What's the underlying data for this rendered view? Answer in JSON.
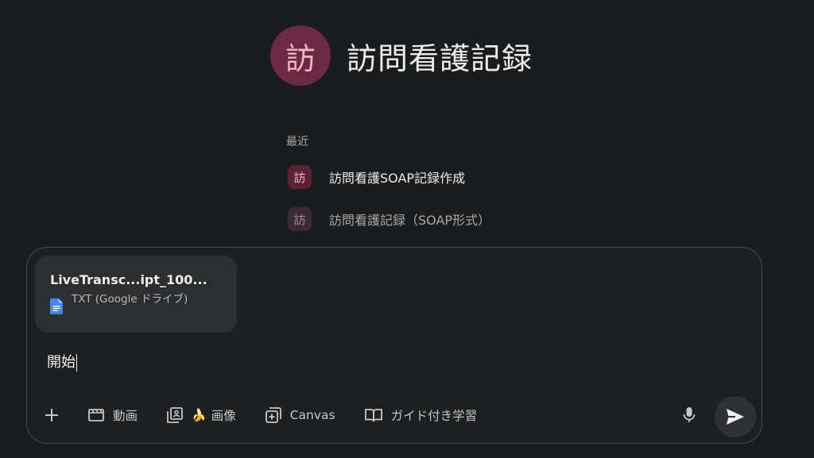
{
  "gem": {
    "avatar_char": "訪",
    "title": "訪問看護記録"
  },
  "recent": {
    "label": "最近",
    "items": [
      {
        "avatar_char": "訪",
        "label": "訪問看護SOAP記録作成"
      },
      {
        "avatar_char": "訪",
        "label": "訪問看護記録（SOAP形式）"
      }
    ]
  },
  "composer": {
    "attachment": {
      "filename": "LiveTransc...ipt_100...",
      "filetype": "TXT (Google ドライブ)",
      "icon": "google-docs-icon"
    },
    "input_value": "開始",
    "tools": [
      {
        "icon": "plus-icon",
        "label": ""
      },
      {
        "icon": "video-icon",
        "label": "動画"
      },
      {
        "icon": "image-gallery-icon",
        "label": "画像",
        "emoji": "🍌"
      },
      {
        "icon": "canvas-icon",
        "label": "Canvas"
      },
      {
        "icon": "book-icon",
        "label": "ガイド付き学習"
      }
    ],
    "mic_icon": "microphone-icon",
    "send_icon": "send-icon"
  },
  "colors": {
    "background": "#1b1c1d",
    "composer_bg": "#1e1f20",
    "avatar": "#6b2a42",
    "doc_blue": "#4285f4"
  }
}
